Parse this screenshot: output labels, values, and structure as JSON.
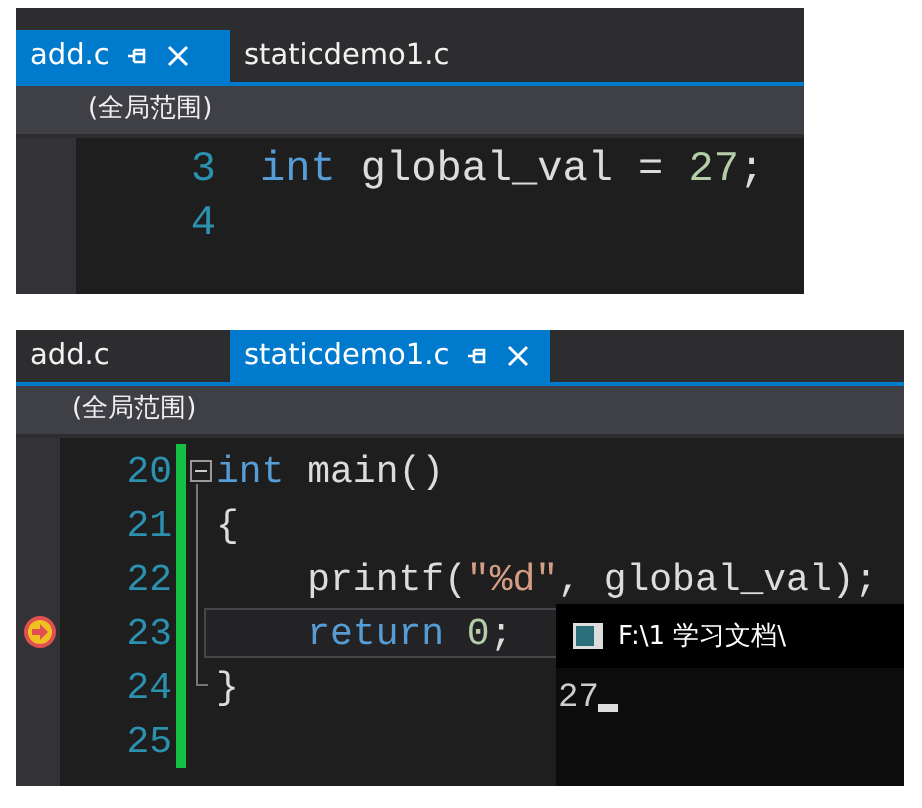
{
  "panes": [
    {
      "tabs": [
        {
          "label": "add.c",
          "selected": true
        },
        {
          "label": "staticdemo1.c",
          "selected": false
        }
      ],
      "scope": "(全局范围)",
      "lines": [
        {
          "number": "3",
          "tokens": [
            {
              "kind": "keyword",
              "text": "int"
            },
            {
              "kind": "plain",
              "text": " global_val = "
            },
            {
              "kind": "number",
              "text": "27"
            },
            {
              "kind": "plain",
              "text": ";"
            }
          ]
        },
        {
          "number": "4"
        }
      ]
    },
    {
      "tabs": [
        {
          "label": "add.c",
          "selected": false
        },
        {
          "label": "staticdemo1.c",
          "selected": true
        }
      ],
      "scope": "(全局范围)",
      "lines": [
        {
          "number": "20",
          "changed": true,
          "collapsible": true,
          "tokens": [
            {
              "kind": "keyword",
              "text": "int"
            },
            {
              "kind": "plain",
              "text": " main()"
            }
          ]
        },
        {
          "number": "21",
          "changed": true,
          "tokens": [
            {
              "kind": "plain",
              "text": "{"
            }
          ]
        },
        {
          "number": "22",
          "changed": true,
          "tokens": [
            {
              "kind": "plain",
              "text": "    printf("
            },
            {
              "kind": "string",
              "text": "\"%d\""
            },
            {
              "kind": "plain",
              "text": ", global_val);"
            }
          ]
        },
        {
          "number": "23",
          "changed": true,
          "current": true,
          "tokens": [
            {
              "kind": "keyword",
              "text": "    return "
            },
            {
              "kind": "number",
              "text": "0"
            },
            {
              "kind": "plain",
              "text": ";"
            }
          ]
        },
        {
          "number": "24",
          "changed": true,
          "block_end": true,
          "tokens": [
            {
              "kind": "plain",
              "text": "}"
            }
          ]
        },
        {
          "number": "25",
          "changed": true
        }
      ],
      "console": {
        "title": "F:\\1 学习文档\\",
        "output": "27"
      }
    }
  ]
}
